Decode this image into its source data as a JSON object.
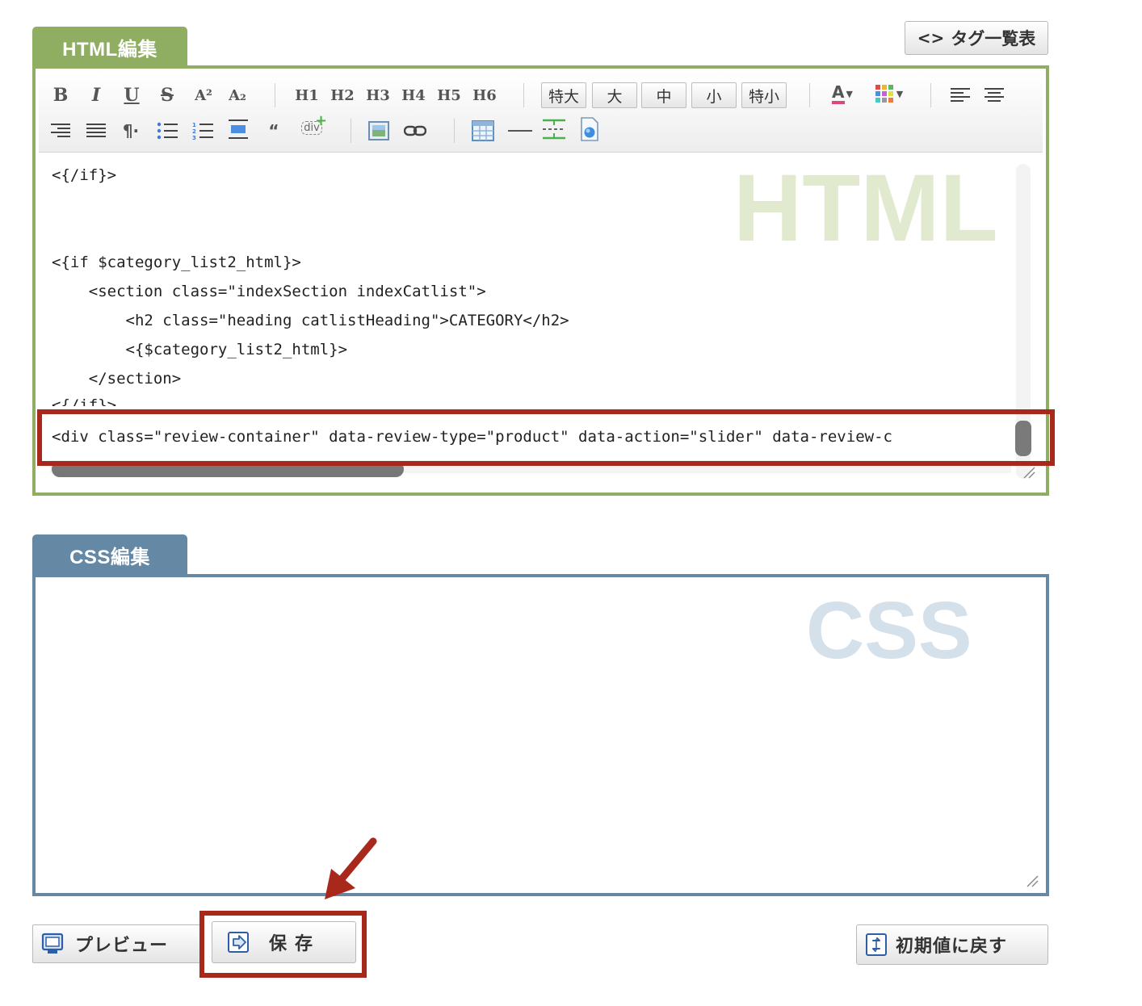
{
  "html_editor": {
    "tab_label": "HTML編集",
    "watermark": "HTML",
    "tag_list_button": "タグ一覧表",
    "toolbar": {
      "bold": "B",
      "italic": "I",
      "underline": "U",
      "strike": "S",
      "superscript": "A²",
      "subscript": "A₂",
      "headings": [
        "H1",
        "H2",
        "H3",
        "H4",
        "H5",
        "H6"
      ],
      "sizes": [
        "特大",
        "大",
        "中",
        "小",
        "特小"
      ],
      "font_color": "A",
      "paragraph": "¶·",
      "quote": "“",
      "div_label": "div"
    },
    "code_lines": [
      "<{/if}>",
      "",
      "",
      "<{if $category_list2_html}>",
      "    <section class=\"indexSection indexCatlist\">",
      "        <h2 class=\"heading catlistHeading\">CATEGORY</h2>",
      "        <{$category_list2_html}>",
      "    </section>",
      "<{/if}>",
      "<div class=\"review-container\" data-review-type=\"product\" data-action=\"slider\" data-review-c"
    ]
  },
  "css_editor": {
    "tab_label": "CSS編集",
    "watermark": "CSS",
    "content": ""
  },
  "buttons": {
    "preview": "プレビュー",
    "save": "保存",
    "reset": "初期値に戻す"
  },
  "colors": {
    "html_accent": "#8fae62",
    "css_accent": "#6589a5",
    "annotation_red": "#a8291c"
  }
}
